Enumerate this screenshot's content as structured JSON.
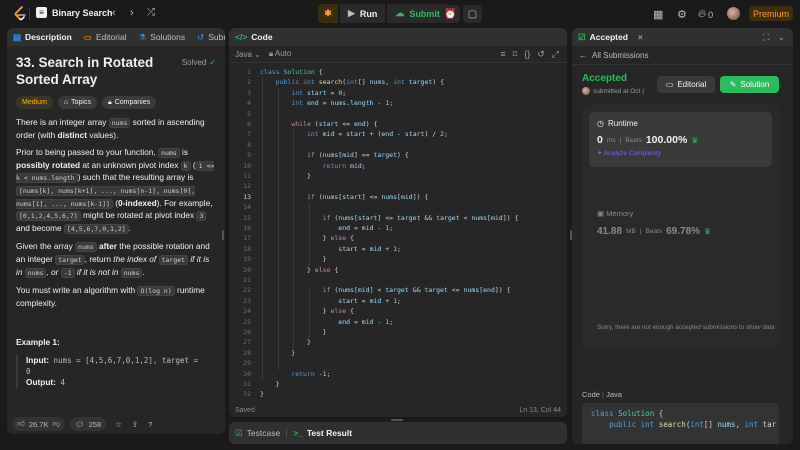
{
  "nav": {
    "problem_list": "Binary Search",
    "run": "Run",
    "submit": "Submit",
    "premium": "Premium",
    "streak": "0"
  },
  "left": {
    "tabs": [
      "Description",
      "Editorial",
      "Solutions",
      "Submis"
    ],
    "title": "33. Search in Rotated Sorted Array",
    "solved": "Solved",
    "chips": [
      "Medium",
      "Topics",
      "Companies"
    ],
    "likes": "26.7K",
    "comments": "258"
  },
  "mid": {
    "tab": "Code",
    "language": "Java",
    "auto": "Auto",
    "status_left": "Saved",
    "status_right": "Ln 13, Col 44",
    "bottom_tabs": [
      "Testcase",
      "Test Result"
    ],
    "lines": [
      "class Solution {",
      "    public int search(int[] nums, int target) {",
      "        int start = 0;",
      "        int end = nums.length - 1;",
      "",
      "        while (start <= end) {",
      "            int mid = start + (end - start) / 2;",
      "",
      "            if (nums[mid] == target) {",
      "                return mid;",
      "            }",
      "",
      "            if (nums[start] <= nums[mid]) {",
      "",
      "                if (nums[start] <= target && target < nums[mid]) {",
      "                    end = mid - 1;",
      "                } else {",
      "                    start = mid + 1;",
      "                }",
      "            } else {",
      "",
      "                if (nums[mid] < target && target <= nums[end]) {",
      "                    start = mid + 1;",
      "                } else {",
      "                    end = mid - 1;",
      "                }",
      "            }",
      "        }",
      "",
      "        return -1;",
      "    }",
      "}"
    ],
    "line_numbers": [
      "1",
      "2",
      "3",
      "4",
      "5",
      "6",
      "7",
      "8",
      "9",
      "10",
      "11",
      "12",
      "13",
      "14",
      "15",
      "16",
      "17",
      "18",
      "19",
      "20",
      "21",
      "22",
      "23",
      "24",
      "25",
      "26",
      "27",
      "28",
      "29",
      "30",
      "31",
      "32"
    ]
  },
  "right": {
    "tab": "Accepted",
    "all_submissions": "All Submissions",
    "status": "Accepted",
    "submitted": "submitted at Oct (",
    "editorial": "Editorial",
    "solution": "Solution",
    "runtime_label": "Runtime",
    "runtime_value": "0",
    "runtime_unit": "ms",
    "beats": "Beats",
    "runtime_beats": "100.00%",
    "analyze": "Analyze Complexity",
    "memory_label": "Memory",
    "memory_value": "41.88",
    "memory_unit": "MB",
    "memory_beats": "69.78%",
    "not_enough": "Sorry, there are not enough accepted submissions to show data",
    "code_label": "Code",
    "code_lang": "Java",
    "code_preview_1": "class Solution {",
    "code_preview_2": "    public int search(int[] nums, int tar"
  }
}
